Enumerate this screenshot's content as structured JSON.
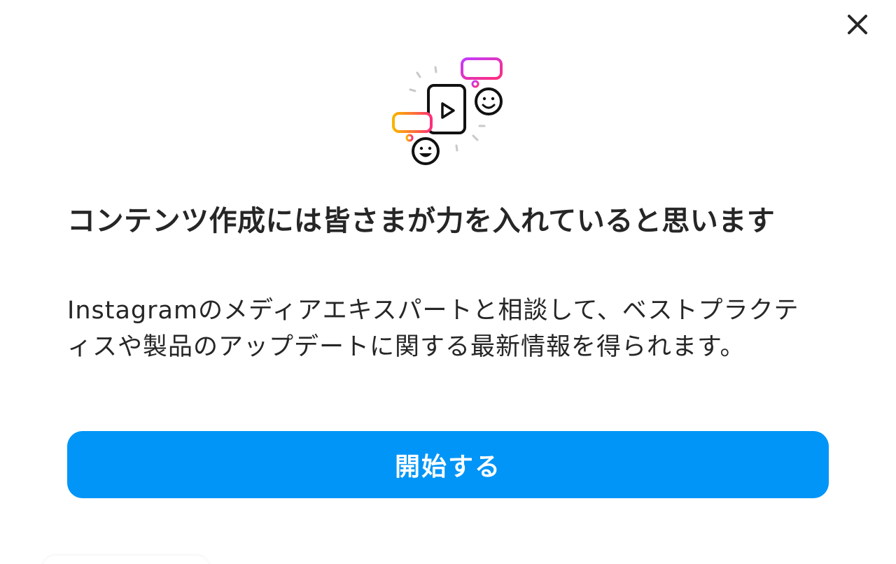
{
  "dialog": {
    "close_icon": "close-icon",
    "illustration_icon": "content-creation-illustration",
    "title": "コンテンツ作成には皆さまが力を入れていると思います",
    "description": "Instagramのメディアエキスパートと相談して、ベストプラクティスや製品のアップデートに関する最新情報を得られます。",
    "start_button_label": "開始する",
    "accent_color": "#0095f6"
  }
}
